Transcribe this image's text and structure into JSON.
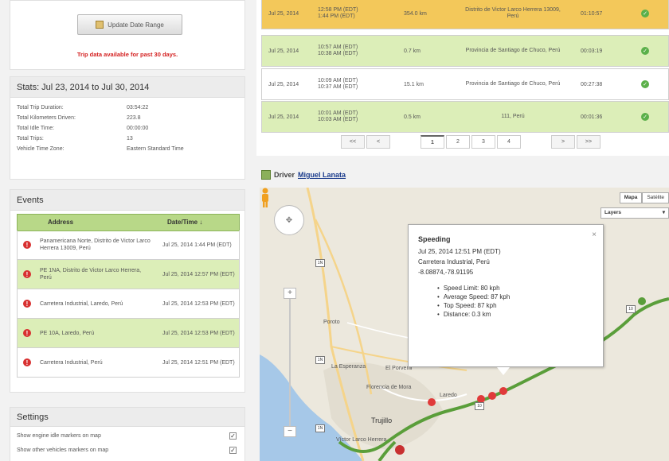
{
  "update": {
    "button_label": "Update Date Range",
    "note": "Trip data available for past 30 days."
  },
  "stats": {
    "title": "Stats: Jul 23, 2014 to Jul 30, 2014",
    "rows": [
      {
        "label": "Total Trip Duration:",
        "value": "03:54:22"
      },
      {
        "label": "Total Kilometers Driven:",
        "value": "223.8"
      },
      {
        "label": "Total Idle Time:",
        "value": "00:00:00"
      },
      {
        "label": "Total Trips:",
        "value": "13"
      },
      {
        "label": "Vehicle Time Zone:",
        "value": "Eastern Standard Time"
      }
    ]
  },
  "events": {
    "title": "Events",
    "col_address": "Address",
    "col_datetime": "Date/Time ↓",
    "rows": [
      {
        "address": "Panamericana Norte, Distrito de Victor Larco Herrera 13009, Perú",
        "datetime": "Jul 25, 2014 1:44 PM (EDT)"
      },
      {
        "address": "PE 1NA, Distrito de Victor Larco Herrera, Perú",
        "datetime": "Jul 25, 2014 12:57 PM (EDT)"
      },
      {
        "address": "Carretera Industrial, Laredo, Perú",
        "datetime": "Jul 25, 2014 12:53 PM (EDT)"
      },
      {
        "address": "PE 10A, Laredo, Perú",
        "datetime": "Jul 25, 2014 12:53 PM (EDT)"
      },
      {
        "address": "Carretera Industrial, Perú",
        "datetime": "Jul 25, 2014 12:51 PM (EDT)"
      }
    ]
  },
  "settings": {
    "title": "Settings",
    "items": [
      {
        "label": "Show engine idle markers on map"
      },
      {
        "label": "Show other vehicles markers on map"
      }
    ]
  },
  "trips": [
    {
      "date": "Jul 25, 2014",
      "time": "1:44 PM (EDT)",
      "time_top": "12:58 PM (EDT)",
      "km": "354.0 km",
      "location": "Distrito de Victor Larco Herrera 13009, Perú",
      "duration": "01:10:57"
    },
    {
      "date": "Jul 25, 2014",
      "time": "10:57 AM (EDT)",
      "time_top": "10:38 AM (EDT)",
      "km": "0.7 km",
      "location": "Provincia de Santiago de Chuco, Perú",
      "duration": "00:03:19"
    },
    {
      "date": "Jul 25, 2014",
      "time": "10:09 AM (EDT)",
      "time_top": "10:37 AM (EDT)",
      "km": "15.1 km",
      "location": "Provincia de Santiago de Chuco, Perú",
      "duration": "00:27:38"
    },
    {
      "date": "Jul 25, 2014",
      "time": "10:01 AM (EDT)",
      "time_top": "10:03 AM (EDT)",
      "km": "0.5 km",
      "location": "111, Perú",
      "duration": "00:01:36"
    }
  ],
  "pager": {
    "first": "<<",
    "prev": "<",
    "pages": [
      "1",
      "2",
      "3",
      "4"
    ],
    "next": ">",
    "last": ">>"
  },
  "driver": {
    "label": "Driver",
    "name": "Miguel Lanata"
  },
  "map": {
    "type_map": "Mapa",
    "type_sat": "Satélite",
    "layers": "Layers",
    "labels": {
      "trujillo": "Trujillo",
      "esperanza": "La Esperanza",
      "porvenir": "El Porvenir",
      "laredo": "Laredo",
      "victor_larco": "Víctor Larco Herrera",
      "florencia": "Florencia de Mora",
      "paijan": "Poroto"
    },
    "route_color": "#5a9e3a",
    "marker_color": "#e03a3a"
  },
  "popup": {
    "title": "Speeding",
    "datetime": "Jul 25, 2014 12:51 PM (EDT)",
    "address": "Carretera Industrial, Perú",
    "coords": "-8.08874,-78.91195",
    "speed_limit": "Speed Limit: 80 kph",
    "avg_speed": "Average Speed: 87 kph",
    "top_speed": "Top Speed: 87 kph",
    "distance": "Distance: 0.3 km",
    "close": "×"
  }
}
